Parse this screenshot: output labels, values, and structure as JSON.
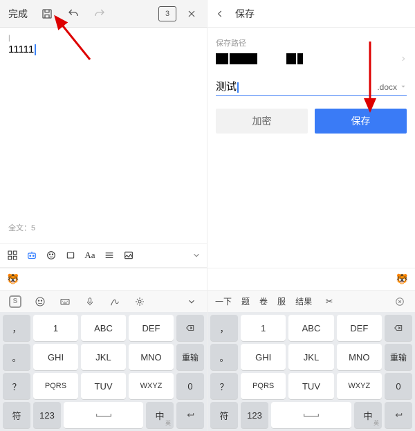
{
  "left": {
    "done": "完成",
    "page_indicator": "3",
    "corner": "|",
    "text": "11111",
    "footer": "全文：5"
  },
  "right": {
    "title": "保存",
    "path_label": "保存路径",
    "filename": "测试",
    "ext": ".docx",
    "btn_encrypt": "加密",
    "btn_save": "保存"
  },
  "kb_left_tools": {
    "logo": "S"
  },
  "kb_right_tools": {
    "t1": "一下",
    "t2": "题",
    "t3": "卷",
    "t4": "服",
    "t5": "结果"
  },
  "keys": {
    "r1": {
      "c1": "，",
      "c2": "1",
      "c3": "ABC",
      "c4": "DEF"
    },
    "r2": {
      "c1": "。",
      "c2": "GHI",
      "c3": "JKL",
      "c4": "MNO",
      "c5": "重输"
    },
    "r3": {
      "c1": "？",
      "c2": "PQRS",
      "c3": "TUV",
      "c4": "WXYZ",
      "c5": "0"
    },
    "r4": {
      "c1": "符",
      "c2": "123",
      "c3": "中",
      "c3sub": "英"
    }
  }
}
